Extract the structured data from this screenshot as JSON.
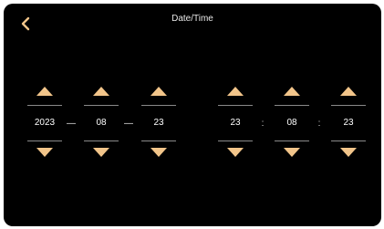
{
  "header": {
    "title": "Date/Time",
    "back_icon": "chevron-left-icon"
  },
  "date": {
    "year": "2023",
    "month": "08",
    "day": "23",
    "separator": "—"
  },
  "time": {
    "hour": "23",
    "minute": "08",
    "second": "23",
    "separator": ":"
  },
  "colors": {
    "background": "#000000",
    "accent": "#f2c58a",
    "text": "#ffffff",
    "divider": "#8a8a8a"
  }
}
